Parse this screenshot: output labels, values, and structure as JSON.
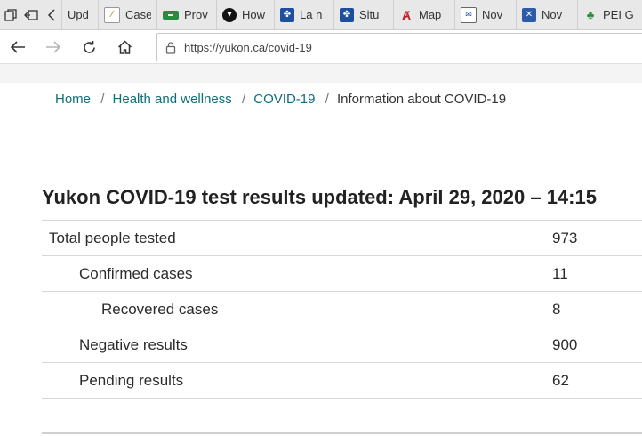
{
  "browser": {
    "tabs": [
      {
        "title": "Upd",
        "icon": "page-icon"
      },
      {
        "title": "Case",
        "icon": "document-icon"
      },
      {
        "title": "Prov",
        "icon": "green-banner-icon"
      },
      {
        "title": "How",
        "icon": "ontario-trillium-icon"
      },
      {
        "title": "La n",
        "icon": "quebec-fleur-de-lis-icon"
      },
      {
        "title": "Situ",
        "icon": "quebec-fleur-de-lis-icon"
      },
      {
        "title": "Map",
        "icon": "red-a-icon"
      },
      {
        "title": "Nov",
        "icon": "envelope-icon"
      },
      {
        "title": "Nov",
        "icon": "nova-scotia-flag-icon"
      },
      {
        "title": "PEI G",
        "icon": "pei-tree-icon"
      }
    ],
    "url": "https://yukon.ca/covid-19"
  },
  "breadcrumb": {
    "items": [
      "Home",
      "Health and wellness",
      "COVID-19"
    ],
    "current": "Information about COVID-19"
  },
  "page": {
    "title": "Yukon COVID-19 test results updated: April 29, 2020 – 14:15"
  },
  "results": [
    {
      "label": "Total people tested",
      "value": "973",
      "level": 0
    },
    {
      "label": "Confirmed cases",
      "value": "11",
      "level": 1
    },
    {
      "label": "Recovered cases",
      "value": "8",
      "level": 2
    },
    {
      "label": "Negative results",
      "value": "900",
      "level": 1
    },
    {
      "label": "Pending results",
      "value": "62",
      "level": 1
    }
  ],
  "colors": {
    "link": "#0f6e7a",
    "text": "#222222",
    "row_border": "#d7d7d7"
  }
}
